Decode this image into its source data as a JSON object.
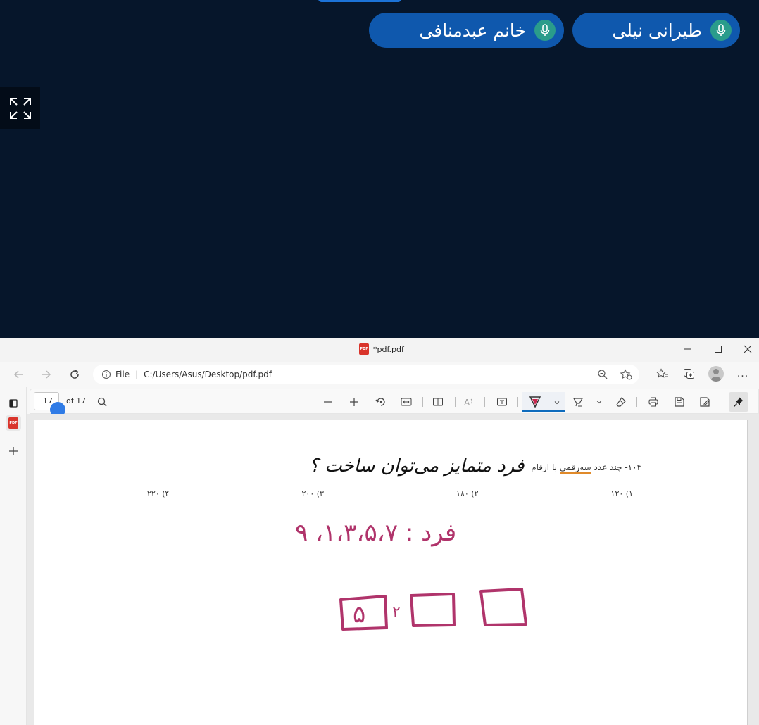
{
  "meeting": {
    "participants": [
      {
        "name": "طیرانی نیلی"
      },
      {
        "name": "خانم عبدمنافی"
      }
    ]
  },
  "window": {
    "title": "*pdf.pdf",
    "file_badge": "PDF"
  },
  "addressbar": {
    "scheme_label": "File",
    "url": "C:/Users/Asus/Desktop/pdf.pdf",
    "more_label": "..."
  },
  "pdf_toolbar": {
    "page_number": "17",
    "page_total_text": "of 17"
  },
  "document": {
    "question_prefix": "۱۰۴- چند عدد ",
    "question_underlined": "سه‌رقمی",
    "question_suffix": " با ارقام",
    "options": [
      "۱) ۱۲۰",
      "۲) ۱۸۰",
      "۳) ۲۰۰",
      "۴) ۲۲۰"
    ],
    "ink_handwriting_black": "فرد متمایز می‌توان ساخت ؟",
    "ink_handwriting_pink": "فرد : ۱،۳،۵،۷، ۹",
    "ink_box_digit": "۵",
    "ink_box_digit2": "۲"
  },
  "colors": {
    "meeting_bg": "#06162b",
    "pill_bg": "#0f58ad",
    "mic_bg": "#2a9c8b",
    "ink_pink": "#b0346b",
    "accent": "#0f6cbd"
  }
}
